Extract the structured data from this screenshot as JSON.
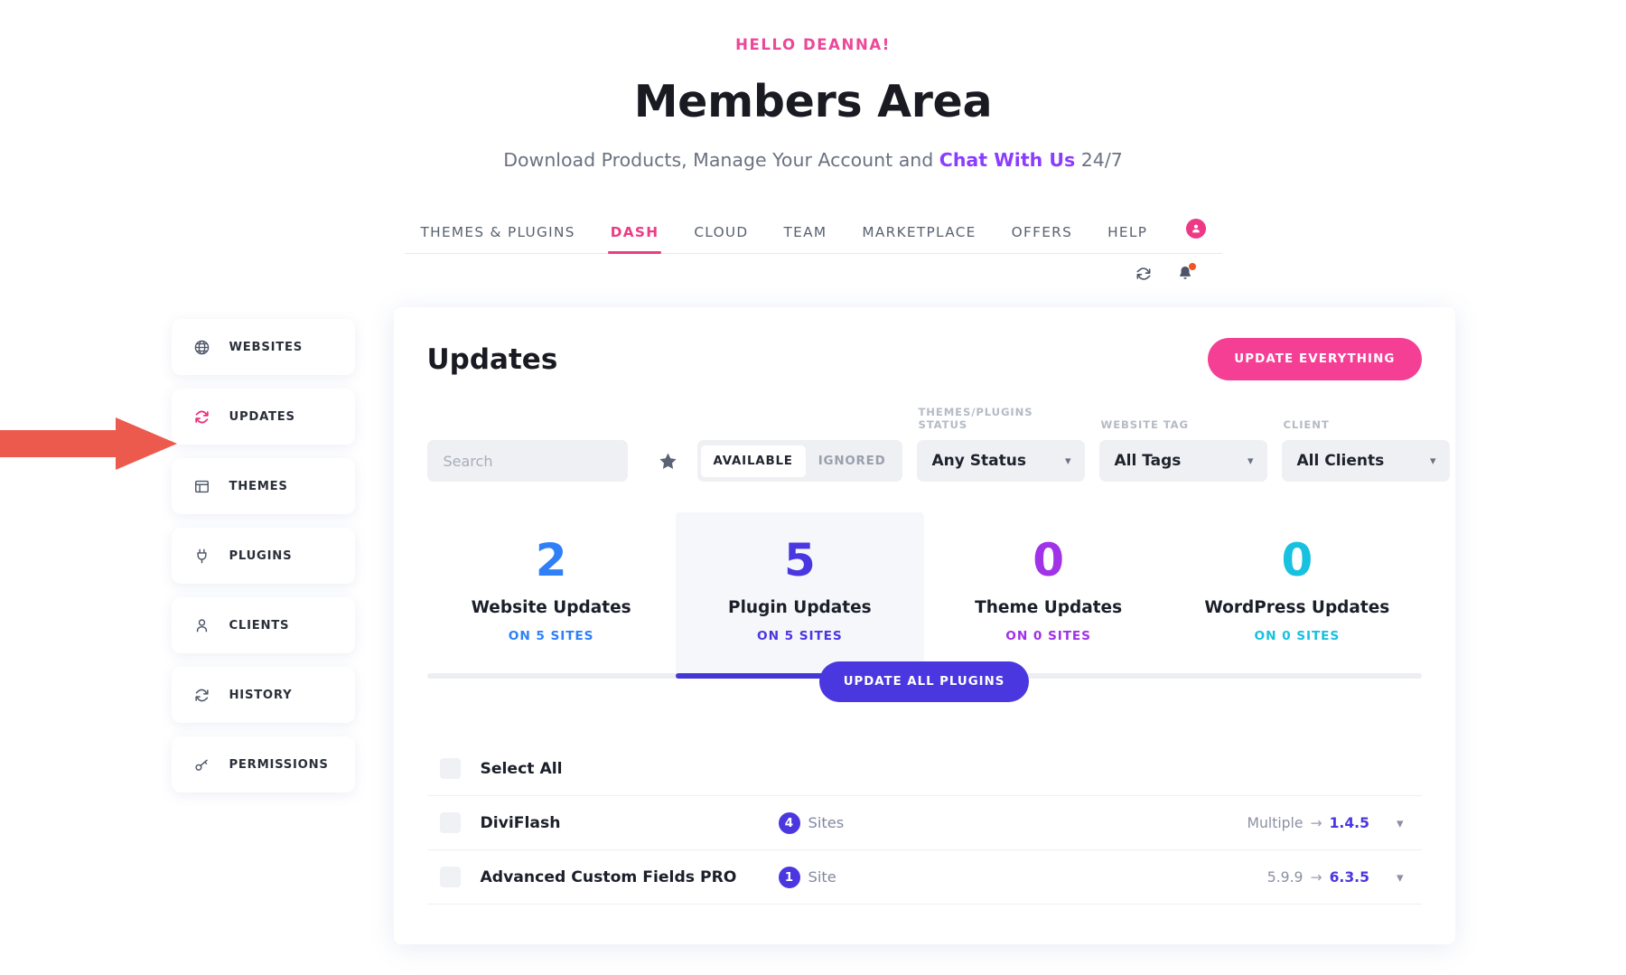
{
  "header": {
    "greeting": "HELLO DEANNA!",
    "title": "Members Area",
    "subtitle_before": "Download Products, Manage Your Account and ",
    "subtitle_link": "Chat With Us",
    "subtitle_after": " 24/7"
  },
  "nav": {
    "items": [
      {
        "label": "THEMES & PLUGINS",
        "active": false
      },
      {
        "label": "DASH",
        "active": true
      },
      {
        "label": "CLOUD",
        "active": false
      },
      {
        "label": "TEAM",
        "active": false
      },
      {
        "label": "MARKETPLACE",
        "active": false
      },
      {
        "label": "OFFERS",
        "active": false
      },
      {
        "label": "HELP",
        "active": false
      }
    ],
    "avatar_icon": "user-circle-icon"
  },
  "utilbar": {
    "refresh_icon": "refresh-icon",
    "bell_icon": "bell-icon",
    "bell_has_alert": true
  },
  "sidebar": {
    "items": [
      {
        "label": "WEBSITES",
        "icon": "globe-icon",
        "active": false
      },
      {
        "label": "UPDATES",
        "icon": "refresh-icon",
        "active": true
      },
      {
        "label": "THEMES",
        "icon": "window-icon",
        "active": false
      },
      {
        "label": "PLUGINS",
        "icon": "plug-icon",
        "active": false
      },
      {
        "label": "CLIENTS",
        "icon": "user-icon",
        "active": false
      },
      {
        "label": "HISTORY",
        "icon": "refresh-icon",
        "active": false
      },
      {
        "label": "PERMISSIONS",
        "icon": "key-icon",
        "active": false
      }
    ]
  },
  "main": {
    "title": "Updates",
    "update_everything_label": "UPDATE EVERYTHING",
    "search": {
      "value": "",
      "placeholder": "Search"
    },
    "favorite_icon": "star-icon",
    "segment": {
      "options": [
        "AVAILABLE",
        "IGNORED"
      ],
      "selected": "AVAILABLE"
    },
    "selects": [
      {
        "label": "THEMES/PLUGINS STATUS",
        "value": "Any Status"
      },
      {
        "label": "WEBSITE TAG",
        "value": "All Tags"
      },
      {
        "label": "CLIENT",
        "value": "All Clients"
      }
    ],
    "update_all_label": "UPDATE ALL PLUGINS",
    "select_all_label": "Select All"
  },
  "chart_data": {
    "type": "bar",
    "title": "Updates summary",
    "categories": [
      "Website Updates",
      "Plugin Updates",
      "Theme Updates",
      "WordPress Updates"
    ],
    "values": [
      2,
      5,
      0,
      0
    ],
    "sublabels": [
      "ON 5 SITES",
      "ON 5 SITES",
      "ON 0 SITES",
      "ON 0 SITES"
    ],
    "colors": [
      "#2f80f7",
      "#4b37e0",
      "#a032e8",
      "#18c1e0"
    ],
    "selected_index": 1,
    "progress_fill_color": "#4337d8"
  },
  "stats": [
    {
      "value": "2",
      "label": "Website Updates",
      "sub": "ON 5 SITES",
      "color": "#2f80f7",
      "selected": false
    },
    {
      "value": "5",
      "label": "Plugin Updates",
      "sub": "ON 5 SITES",
      "color": "#4b37e0",
      "selected": true
    },
    {
      "value": "0",
      "label": "Theme Updates",
      "sub": "ON 0 SITES",
      "color": "#a032e8",
      "selected": false
    },
    {
      "value": "0",
      "label": "WordPress Updates",
      "sub": "ON 0 SITES",
      "color": "#18c1e0",
      "selected": false
    }
  ],
  "list": {
    "rows": [
      {
        "name": "DiviFlash",
        "count": "4",
        "count_label": "Sites",
        "version_from": "Multiple",
        "version_to": "1.4.5"
      },
      {
        "name": "Advanced Custom Fields PRO",
        "count": "1",
        "count_label": "Site",
        "version_from": "5.9.9",
        "version_to": "6.3.5"
      }
    ]
  },
  "annotation": {
    "arrow_icon": "red-pointer-arrow",
    "color": "#ec5a4e"
  }
}
